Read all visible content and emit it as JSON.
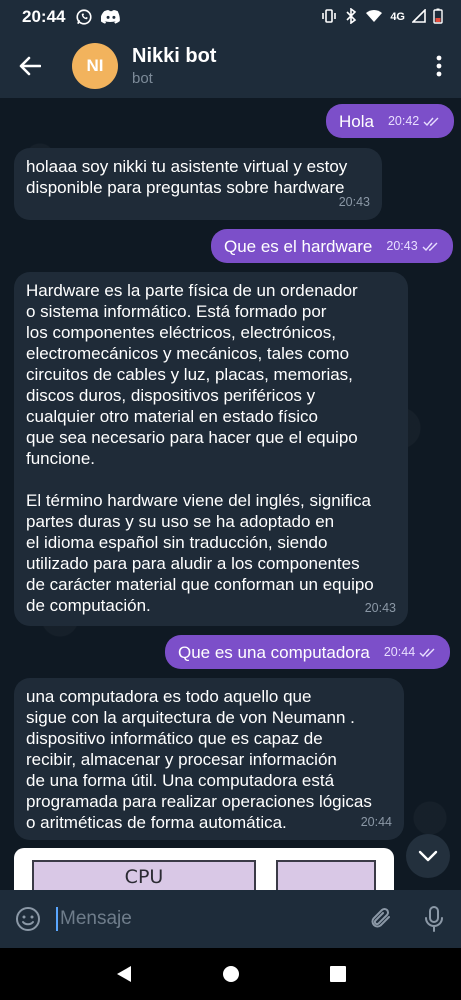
{
  "status_bar": {
    "time": "20:44",
    "network": "4G",
    "icons": [
      "whatsapp-icon",
      "discord-icon",
      "vibrate-icon",
      "bluetooth-data-icon",
      "wifi-icon",
      "signal-icon",
      "battery-icon"
    ]
  },
  "header": {
    "avatar_initials": "NI",
    "avatar_color": "#f2b35d",
    "title": "Nikki bot",
    "subtitle": "bot"
  },
  "messages": [
    {
      "type": "out",
      "text": "Hola",
      "time": "20:42"
    },
    {
      "type": "in",
      "text": "holaaa soy nikki tu asistente virtual y estoy\ndisponible para  preguntas sobre hardware",
      "time": "20:43"
    },
    {
      "type": "out",
      "text": "Que es el hardware",
      "time": "20:43"
    },
    {
      "type": "in",
      "text": "Hardware es la parte física de un ordenador\no sistema informático. Está formado por\nlos componentes eléctricos, electrónicos,\nelectromecánicos y mecánicos, tales como\ncircuitos de cables y luz, placas, memorias,\ndiscos duros, dispositivos periféricos y\ncualquier otro material en estado físico\nque sea necesario para hacer que el equipo\nfuncione.\n\nEl término hardware viene del inglés, significa\npartes duras y su uso se ha adoptado en\nel idioma español sin traducción, siendo\nutilizado para para aludir a los componentes\nde carácter material que conforman un equipo\nde computación.",
      "time": "20:43"
    },
    {
      "type": "out",
      "text": "Que es una computadora",
      "time": "20:44"
    },
    {
      "type": "in",
      "text": "una computadora es todo aquello que\nsigue con la arquitectura de von Neumann .\ndispositivo informático que es capaz de\nrecibir, almacenar y procesar información\nde una forma útil. Una computadora está\nprogramada para realizar operaciones lógicas\no aritméticas de forma automática.",
      "time": "20:44"
    }
  ],
  "image_preview": {
    "label": "CPU"
  },
  "input": {
    "placeholder": "Mensaje",
    "value": ""
  },
  "colors": {
    "outgoing_bubble": "#7c4fc9",
    "incoming_bubble": "#1f2b38",
    "header_bg": "#1e2c3a",
    "chat_bg": "#0f1923"
  }
}
